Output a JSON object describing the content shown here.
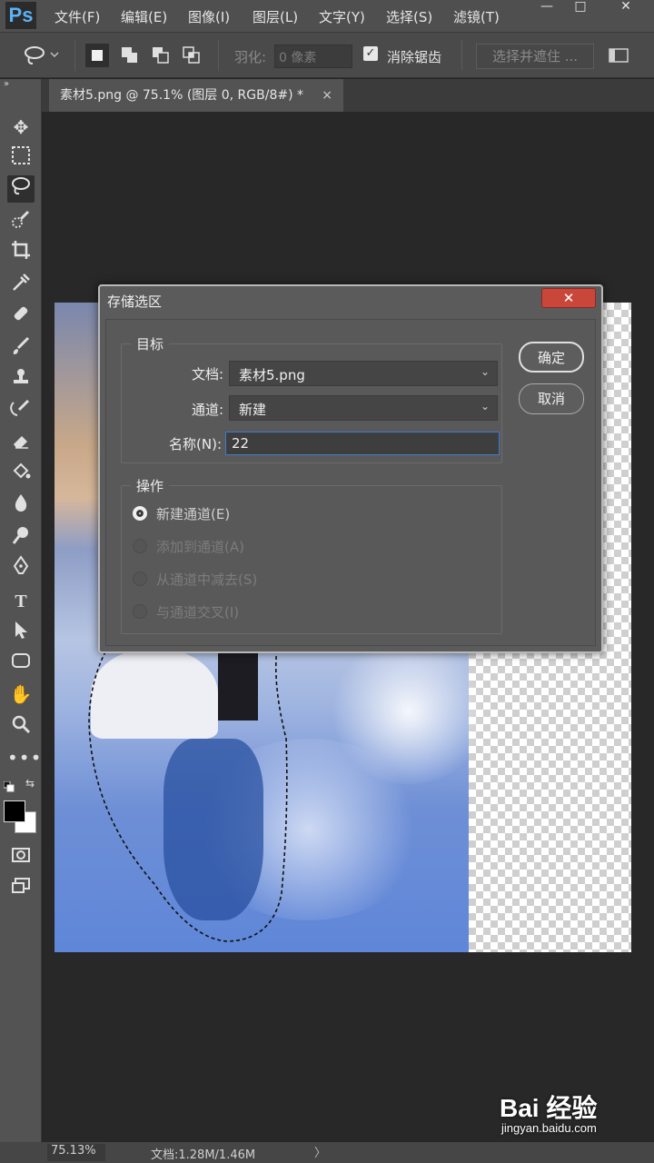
{
  "app": {
    "logo": "Ps",
    "menu": [
      "文件(F)",
      "编辑(E)",
      "图像(I)",
      "图层(L)",
      "文字(Y)",
      "选择(S)",
      "滤镜(T)"
    ],
    "window_controls": [
      "—",
      "□",
      "✕"
    ]
  },
  "options": {
    "feather_label": "羽化:",
    "feather_value": "0 像素",
    "antialias_label": "消除锯齿",
    "antialias_checked": true,
    "select_and_mask": "选择并遮住 ..."
  },
  "tab": {
    "title": "素材5.png @ 75.1% (图层 0, RGB/8#) *",
    "close": "×"
  },
  "tools": {
    "active": "lasso-tool"
  },
  "dialog": {
    "title": "存储选区",
    "close": "✕",
    "target_group": "目标",
    "document_label": "文档:",
    "document_value": "素材5.png",
    "channel_label": "通道:",
    "channel_value": "新建",
    "name_label": "名称(N):",
    "name_value": "22",
    "operation_group": "操作",
    "operations": [
      {
        "label": "新建通道(E)",
        "selected": true,
        "enabled": true
      },
      {
        "label": "添加到通道(A)",
        "selected": false,
        "enabled": false
      },
      {
        "label": "从通道中减去(S)",
        "selected": false,
        "enabled": false
      },
      {
        "label": "与通道交叉(I)",
        "selected": false,
        "enabled": false
      }
    ],
    "ok_button": "确定",
    "cancel_button": "取消"
  },
  "status": {
    "zoom": "75.13%",
    "doc_size": "文档:1.28M/1.46M",
    "arrow": "〉"
  },
  "watermark": {
    "logo": "Bai 经验",
    "url": "jingyan.baidu.com"
  }
}
